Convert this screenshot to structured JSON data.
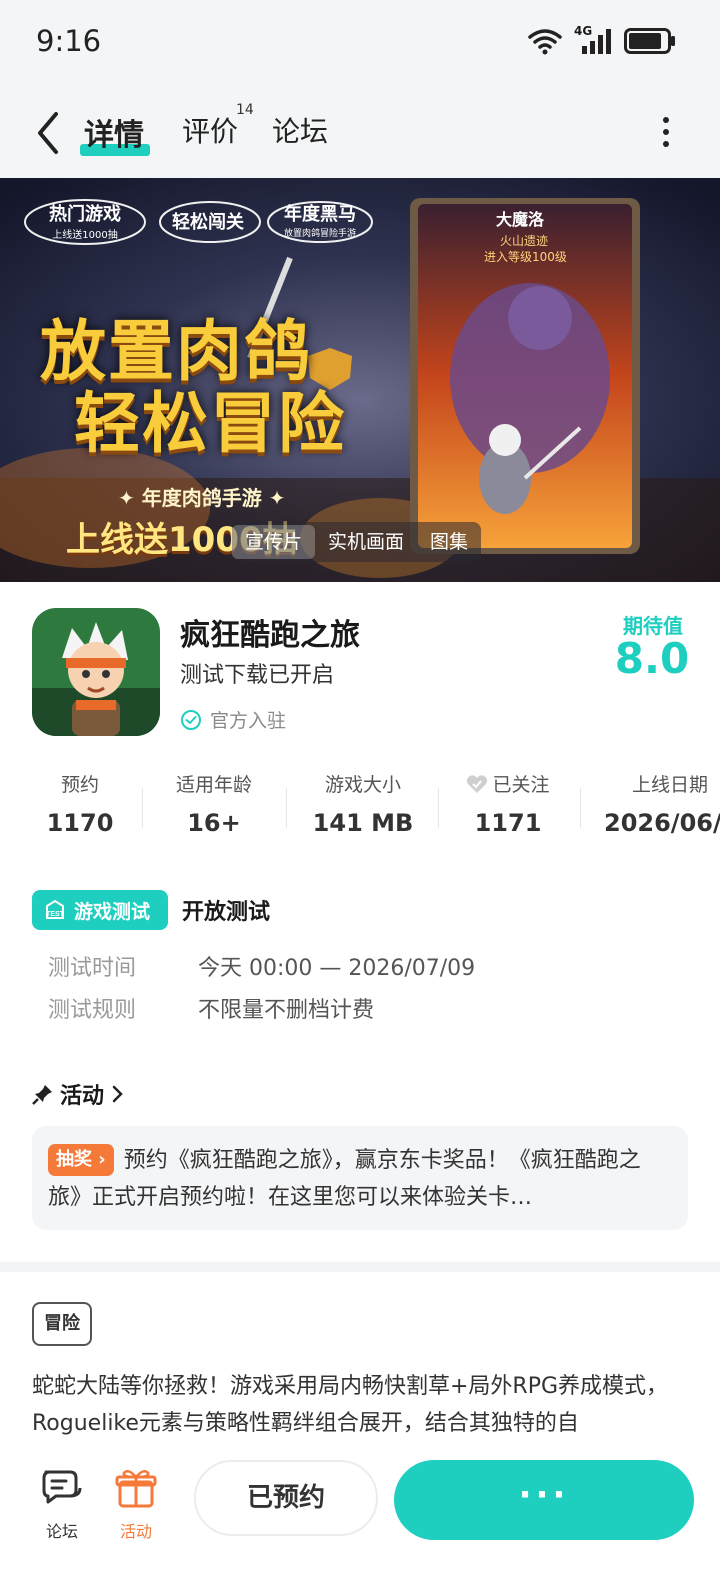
{
  "status_bar": {
    "time": "9:16",
    "network": "4G"
  },
  "header": {
    "tabs": [
      {
        "label": "详情",
        "active": true
      },
      {
        "label": "评价",
        "badge": "14"
      },
      {
        "label": "论坛"
      }
    ]
  },
  "banner": {
    "badges": [
      "热门游戏",
      "上线送1000抽",
      "轻松闯关",
      "年度黑马",
      "放置肉鸽冒险手游"
    ],
    "headline_1": "放置肉鸽",
    "headline_2": "轻松冒险",
    "slogan": "✦ 年度肉鸽手游 ✦",
    "promo": "上线送1000抽",
    "card_title": "大魔洛",
    "card_sub1": "火山遗迹",
    "card_sub2": "进入等级100级",
    "media_tabs": [
      "宣传片",
      "实机画面",
      "图集"
    ]
  },
  "app": {
    "name": "疯狂酷跑之旅",
    "subtitle": "测试下载已开启",
    "official": "官方入驻",
    "expect_label": "期待值",
    "expect_value": "8.0"
  },
  "stats": [
    {
      "label": "预约",
      "value": "1170"
    },
    {
      "label": "适用年龄",
      "value": "16+"
    },
    {
      "label": "游戏大小",
      "value": "141 MB"
    },
    {
      "label": "已关注",
      "value": "1171"
    },
    {
      "label": "上线日期",
      "value": "2026/06/"
    }
  ],
  "test": {
    "badge": "游戏测试",
    "title": "开放测试",
    "time_label": "测试时间",
    "time_value": "今天 00:00 — 2026/07/09",
    "rule_label": "测试规则",
    "rule_value": "不限量不删档计费"
  },
  "activity": {
    "heading": "活动",
    "tag": "抽奖",
    "text": "预约《疯狂酷跑之旅》，赢京东卡奖品！《疯狂酷跑之旅》正式开启预约啦！在这里您可以来体验关卡…"
  },
  "genre_tag": "冒险",
  "description": "蛇蛇大陆等你拯救！游戏采用局内畅快割草+局外RPG养成模式，Roguelike元素与策略性羁绊组合展开，结合其独特的自",
  "bottom": {
    "forum_label": "论坛",
    "activity_label": "活动",
    "reserved_label": "已预约",
    "more_label": "···"
  },
  "colors": {
    "accent": "#1ecfc0",
    "orange": "#f57a3a"
  }
}
